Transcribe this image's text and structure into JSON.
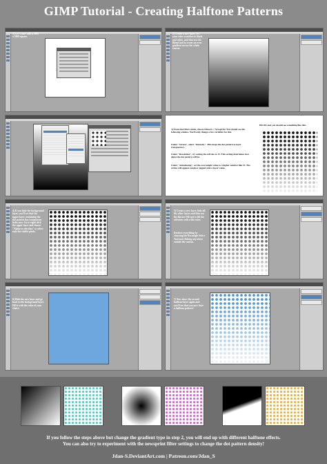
{
  "title": "GIMP Tutorial - Creating Halftone Patterns",
  "steps": {
    "s1": "1) Let's start with a 1000 x 1000 square.",
    "s2": "2) Create a new layer. Set your color swatches to black and white, and then use the Blend tool to create an even gradient across the whole canvas.",
    "s3": "3) From the Filters menu, choose Distorts > Newsprint. You should see the following window. You'll only change a few variables for this.",
    "s3b": "Under \"Screen\", select \"Intensity\". This maps the dot pattern to layer transparency.",
    "s3c": "Under \"Resolution\", try setting the cell size to 15. This setting determines how dense the dot pattern will be.",
    "s3d": "Under \"Antialiasing\", set the oversample value to a higher number like 15. The circles will appear rough or jagged with a lower value.",
    "s3e": "Hit OK and you should see something like this:",
    "s4": "4) If you hide the background layer, you'll see that the upper layer containing the dot pattern has transparent holes now. Go to right click the upper layer and choose \"Alpha to selection\" to select only the visible pixels.",
    "s5": "5) Create a new layer, hide all the other layers and then use the Bucket Fill tool to fill the selection with a flat color.",
    "s5b": "Deselect everything by choosing the Rectangle Select Tool and clicking anywhere outside the canvas.",
    "s6": "6) Hide the new layer and go back to the background layer. Fill it with the color of your choice.",
    "s7": "7) Now show the second halftone layer again and you'll see that you now have a halftone pattern!"
  },
  "footer": {
    "line1": "If you follow the steps above but change the gradient type in step 2, you will end up with different halftone effects.",
    "line2": "You can also try to experiment with the newsprint filter settings to change the dot pattern density!",
    "credit": "Jdan-S.DeviantArt.com | Patreon.com/Jdan_S"
  }
}
